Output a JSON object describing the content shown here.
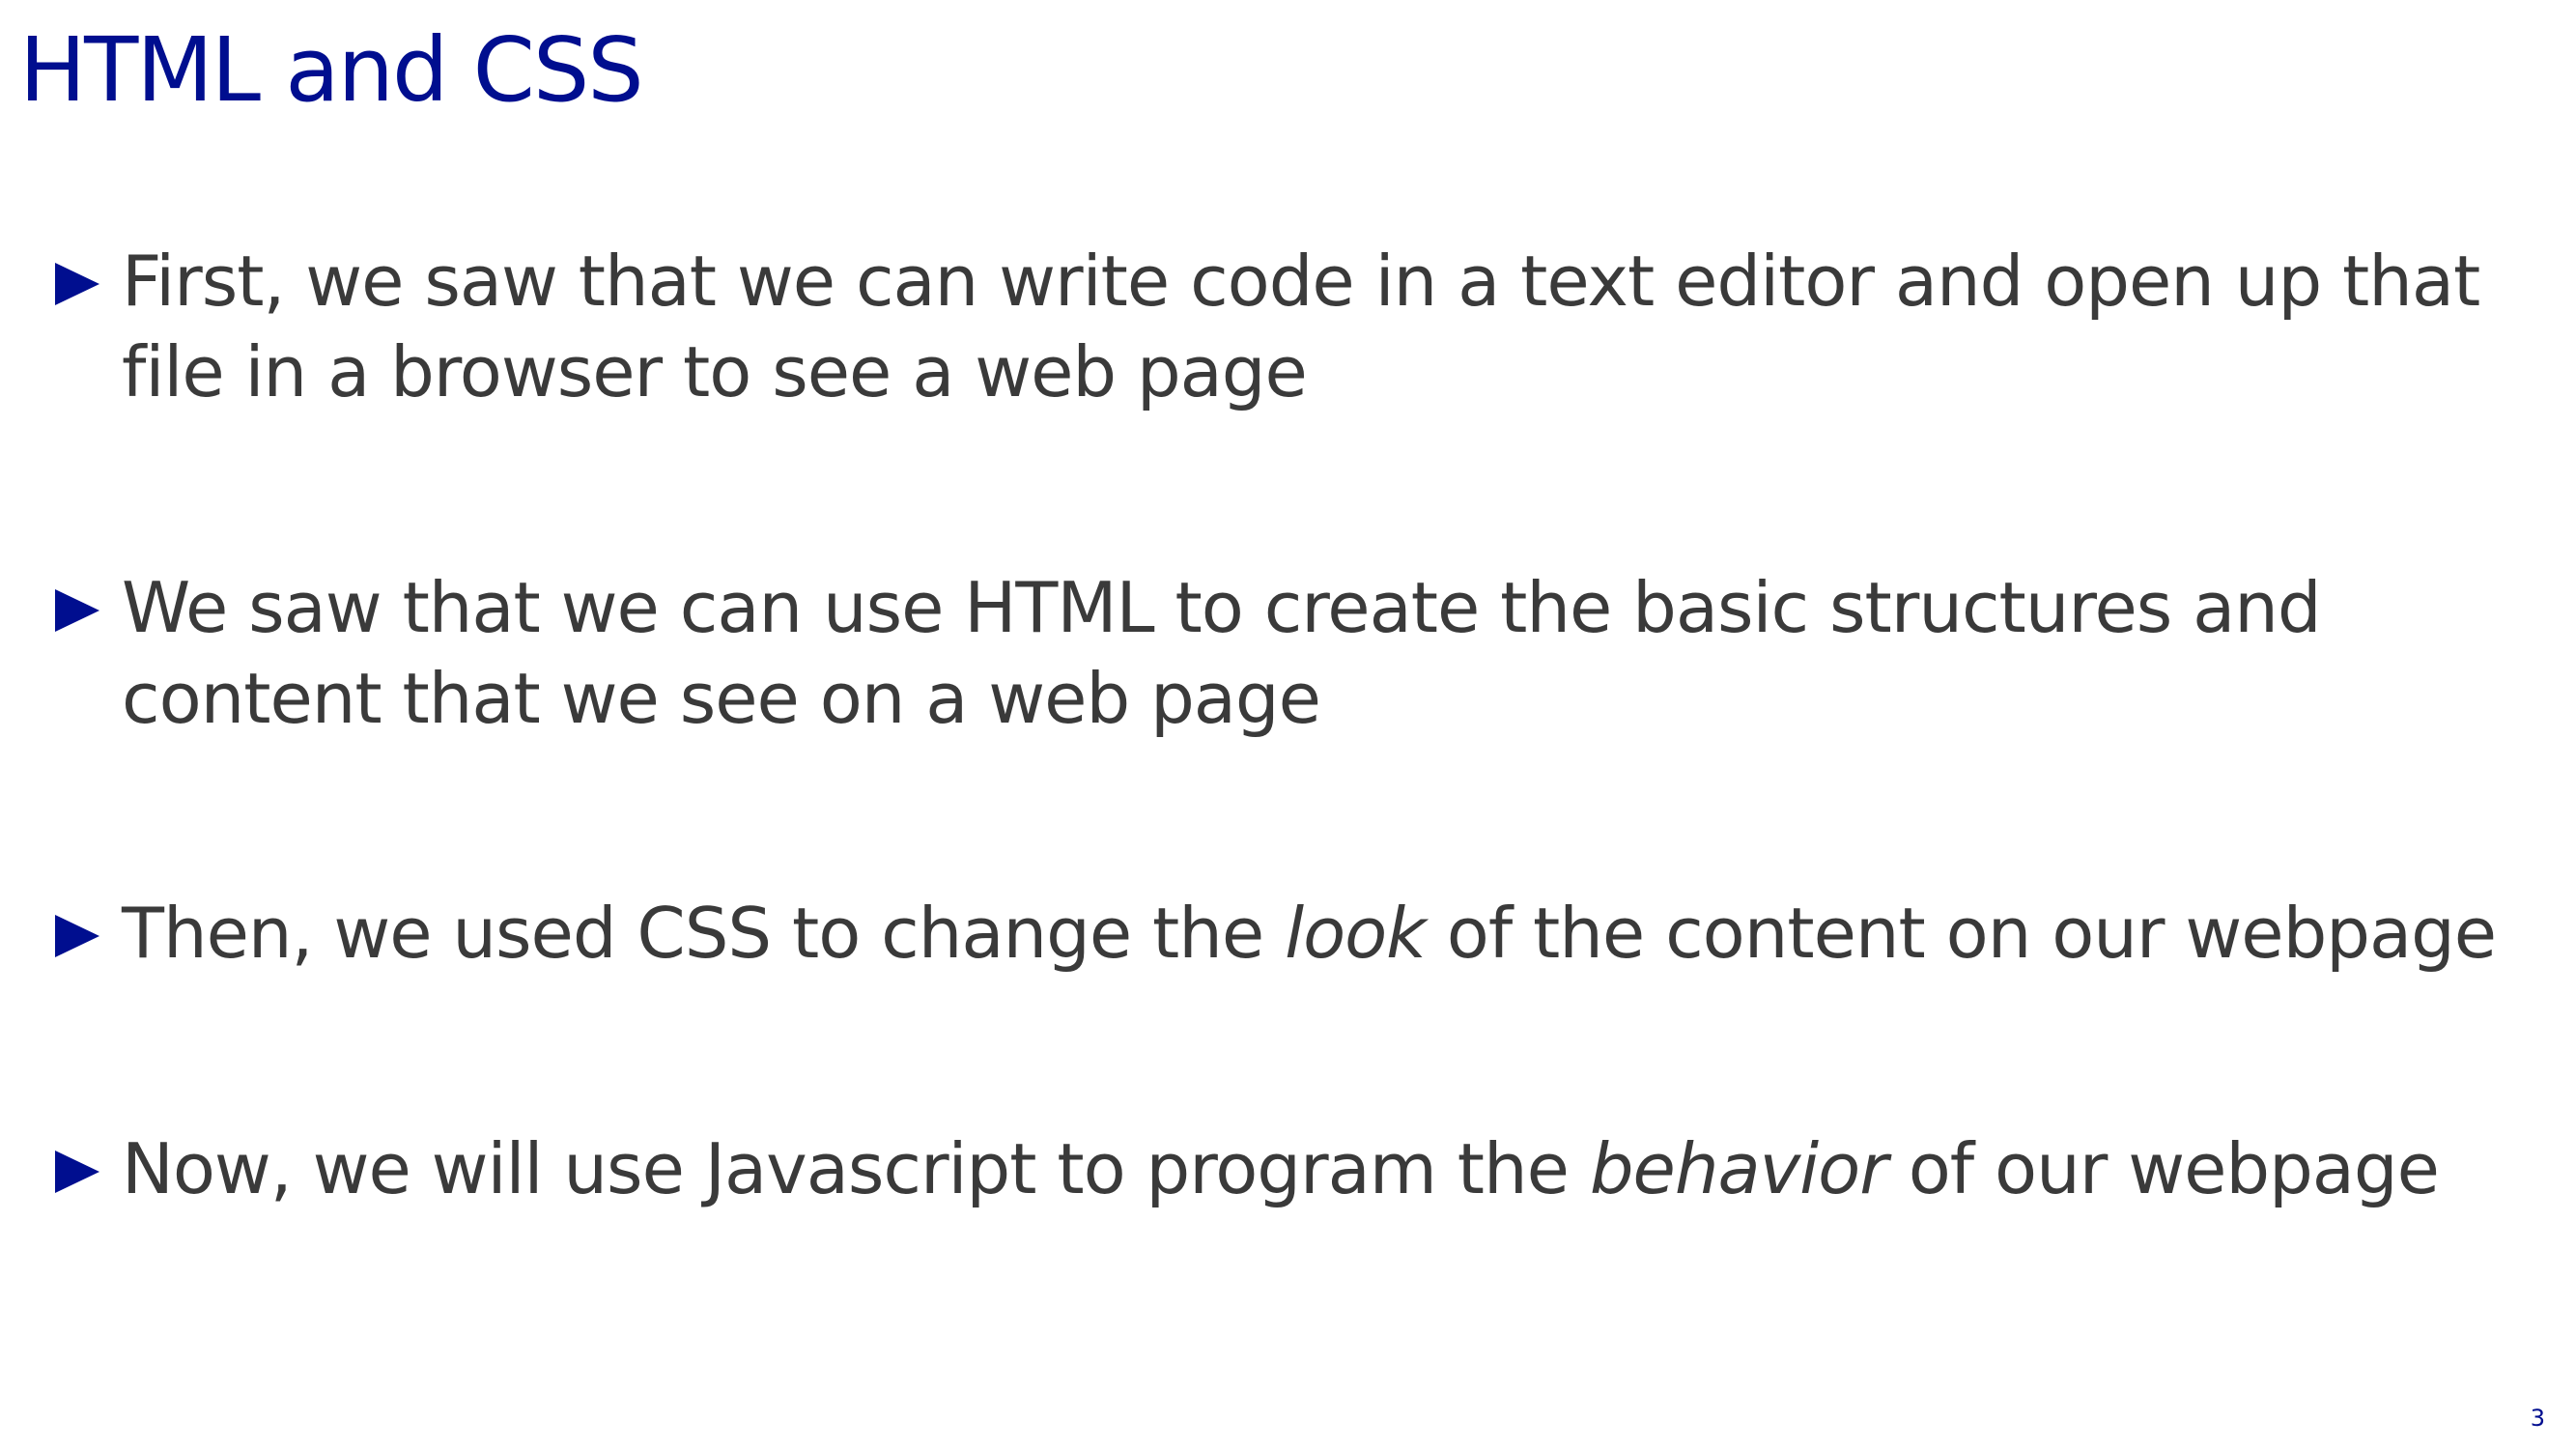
{
  "slide": {
    "title": "HTML and CSS",
    "page_number": "3"
  },
  "bullets": [
    {
      "line1": "First, we saw that we can write code in a text editor and open up that",
      "line2": "file in a browser to see a web page"
    },
    {
      "line1": "We saw that we can use HTML to create the basic structures and",
      "line2": "content that we see on a web page"
    },
    {
      "before": "Then, we used CSS to change the ",
      "emphasis": "look",
      "after": " of the content on our webpage"
    },
    {
      "before": "Now, we will use Javascript to program the ",
      "emphasis": "behavior",
      "after": " of our webpage"
    }
  ],
  "colors": {
    "title": "#000e8f",
    "body_text": "#3a3a3a",
    "bullet_marker": "#000e8f"
  },
  "icons": {
    "bullet": "triangle-right-icon"
  }
}
